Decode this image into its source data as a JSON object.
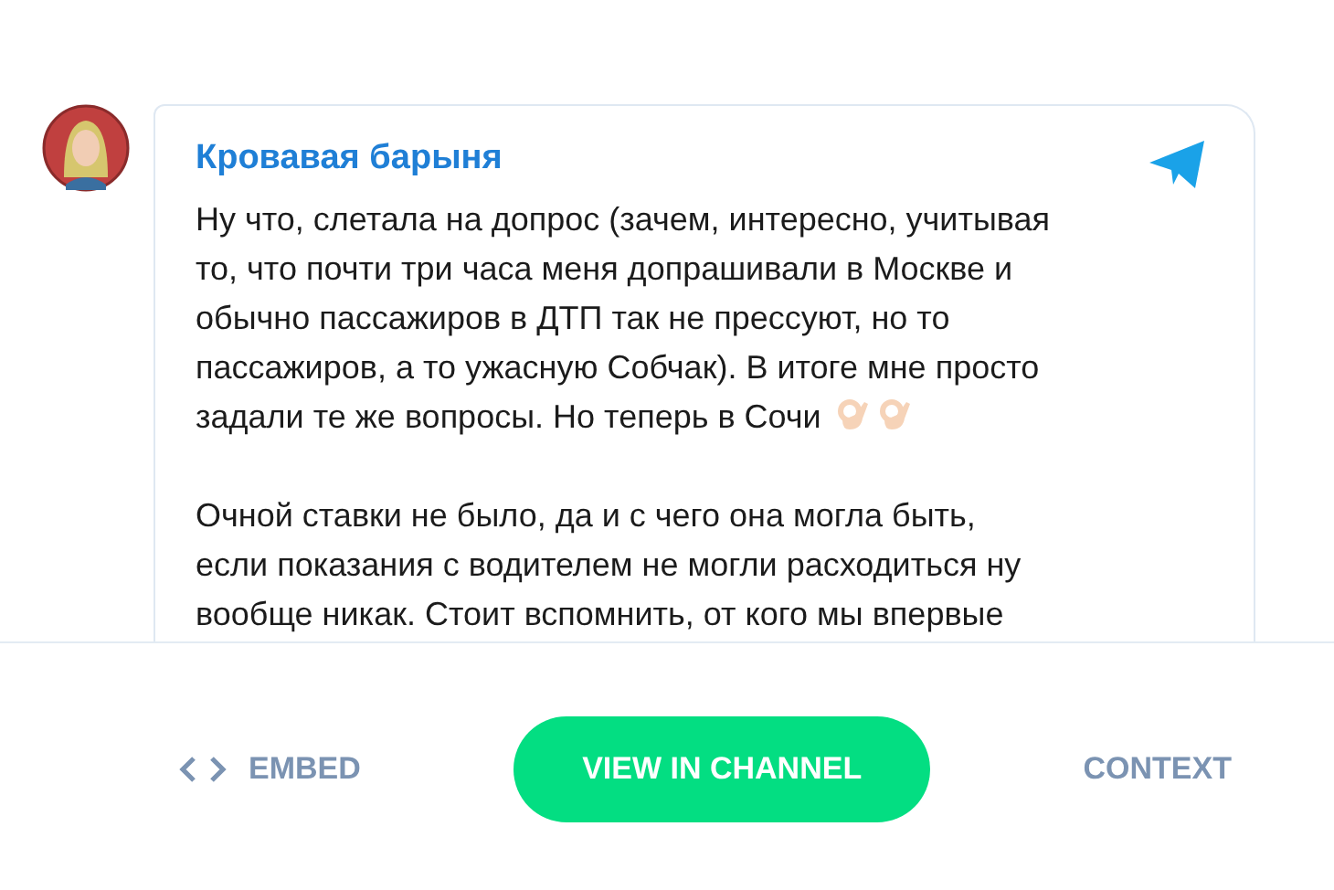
{
  "post": {
    "author": "Кровавая барыня",
    "paragraphs": [
      [
        "Ну что, слетала на допрос (зачем, интересно, учитывая",
        "то, что почти три часа меня допрашивали в Москве и",
        "обычно пассажиров в ДТП так не прессуют, но то",
        "пассажиров, а то ужасную Собчак). В итоге мне просто",
        "задали те же вопросы. Но теперь в Сочи"
      ],
      [
        "Очной ставки не было, да и с чего она могла быть,",
        "если показания с водителем не могли расходиться ну",
        "вообще никак. Стоит вспомнить, от кого мы впервые"
      ]
    ]
  },
  "actions": [
    {
      "label": "EMBED",
      "kind": "embed"
    },
    {
      "label": "VIEW IN CHANNEL",
      "kind": "primary"
    },
    {
      "label": "CONTEXT",
      "kind": "plain"
    }
  ]
}
